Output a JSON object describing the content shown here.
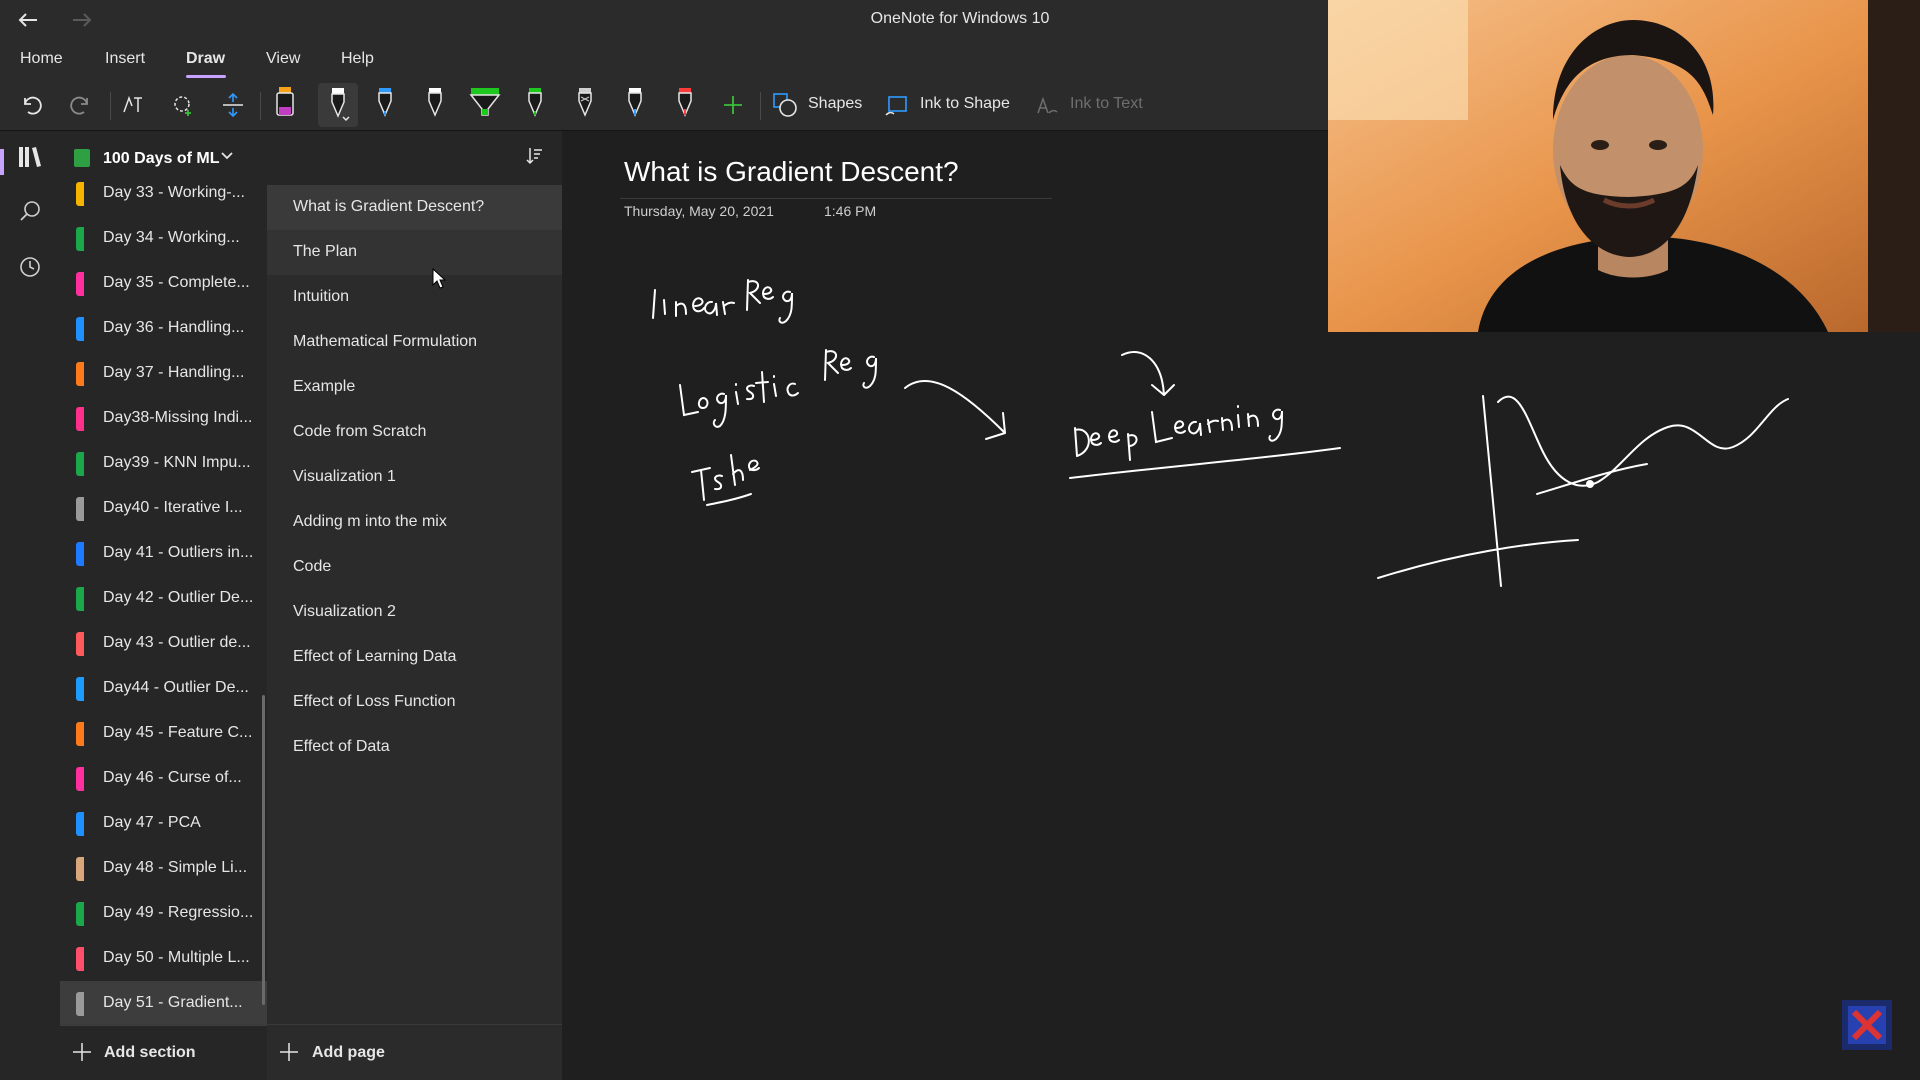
{
  "app": {
    "title": "OneNote for Windows 10"
  },
  "menu": [
    {
      "label": "Home",
      "active": false
    },
    {
      "label": "Insert",
      "active": false
    },
    {
      "label": "Draw",
      "active": true
    },
    {
      "label": "View",
      "active": false
    },
    {
      "label": "Help",
      "active": false
    }
  ],
  "toolbar": {
    "shapes_label": "Shapes",
    "ink_to_shape_label": "Ink to Shape",
    "ink_to_text_label": "Ink to Text",
    "pen_colors": [
      "#c13ec1",
      "#ffffff",
      "#2f9bff",
      "#ffffff",
      "#1ec81e",
      "#1ec81e",
      "#cfcfcf",
      "#2f9bff",
      "#ff3b3b"
    ],
    "add_pen_color": "#3bbf3b"
  },
  "notebook": {
    "name": "100 Days of ML",
    "color": "#2ea043"
  },
  "sections": [
    {
      "label": "Day 33 - Working-...",
      "color": "#f5b400"
    },
    {
      "label": "Day 34 - Working...",
      "color": "#1aa84a"
    },
    {
      "label": "Day 35 - Complete...",
      "color": "#ff2fa0"
    },
    {
      "label": "Day 36 - Handling...",
      "color": "#1e90ff"
    },
    {
      "label": "Day 37 - Handling...",
      "color": "#ff7a1a"
    },
    {
      "label": "Day38-Missing Indi...",
      "color": "#ff2f8a"
    },
    {
      "label": "Day39 - KNN Impu...",
      "color": "#1aa84a"
    },
    {
      "label": "Day40 - Iterative I...",
      "color": "#9a9a9a"
    },
    {
      "label": "Day 41 - Outliers in...",
      "color": "#1e7bff"
    },
    {
      "label": "Day 42 - Outlier De...",
      "color": "#1aa84a"
    },
    {
      "label": "Day 43 - Outlier de...",
      "color": "#ff5a5a"
    },
    {
      "label": "Day44 - Outlier De...",
      "color": "#1e9bff"
    },
    {
      "label": "Day 45 - Feature C...",
      "color": "#ff7a1a"
    },
    {
      "label": "Day 46 - Curse of...",
      "color": "#ff2fa0"
    },
    {
      "label": "Day 47 - PCA",
      "color": "#1e90ff"
    },
    {
      "label": "Day 48 - Simple Li...",
      "color": "#d9a77a"
    },
    {
      "label": "Day 49 - Regressio...",
      "color": "#1aa84a"
    },
    {
      "label": "Day 50 - Multiple L...",
      "color": "#ff4f6a"
    },
    {
      "label": "Day 51 - Gradient...",
      "color": "#9a9a9a"
    }
  ],
  "selected_section_index": 18,
  "pages": [
    "What is Gradient Descent?",
    "The Plan",
    "Intuition",
    "Mathematical Formulation",
    "Example",
    "Code from Scratch",
    "Visualization 1",
    "Adding m into the mix",
    "Code",
    "Visualization 2",
    "Effect of Learning Data",
    "Effect of Loss Function",
    "Effect of Data"
  ],
  "footer": {
    "add_section": "Add section",
    "add_page": "Add page"
  },
  "page_content": {
    "title": "What is Gradient Descent?",
    "date": "Thursday, May 20, 2021",
    "time": "1:46 PM",
    "ink_text": [
      "Linear Reg",
      "Logistic Reg",
      "Tshe",
      "Deep Learning"
    ]
  }
}
